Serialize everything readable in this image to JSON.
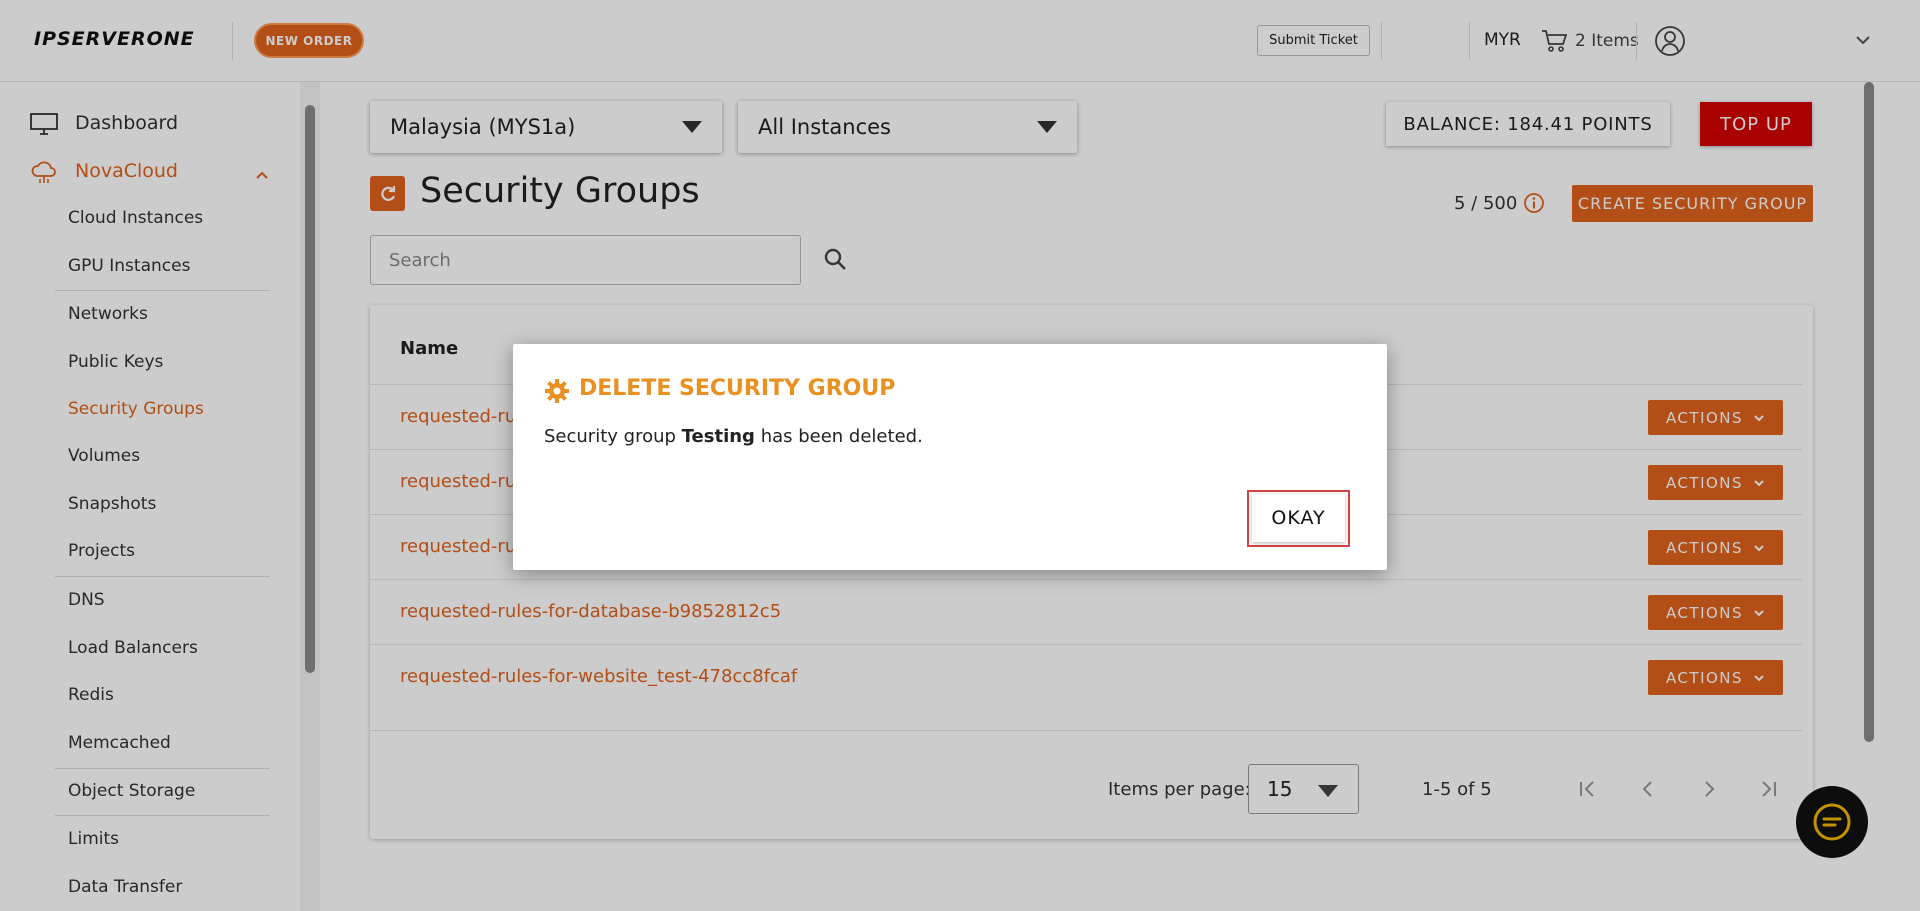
{
  "header": {
    "logo": "IPSERVERONE",
    "new_order": "NEW ORDER",
    "submit_ticket": "Submit Ticket",
    "currency": "MYR",
    "cart": "2 Items"
  },
  "sidebar": {
    "dashboard": "Dashboard",
    "novacloud": "NovaCloud",
    "items": [
      {
        "label": "Cloud Instances"
      },
      {
        "label": "GPU Instances"
      },
      {
        "label": "Networks"
      },
      {
        "label": "Public Keys"
      },
      {
        "label": "Security Groups"
      },
      {
        "label": "Volumes"
      },
      {
        "label": "Snapshots"
      },
      {
        "label": "Projects"
      },
      {
        "label": "DNS"
      },
      {
        "label": "Load Balancers"
      },
      {
        "label": "Redis"
      },
      {
        "label": "Memcached"
      },
      {
        "label": "Object Storage"
      },
      {
        "label": "Limits"
      },
      {
        "label": "Data Transfer"
      }
    ]
  },
  "toolbar": {
    "region": "Malaysia (MYS1a)",
    "instances": "All Instances",
    "balance": "BALANCE: 184.41 POINTS",
    "topup": "TOP UP"
  },
  "page": {
    "title": "Security Groups",
    "quota": "5 / 500",
    "create": "CREATE SECURITY GROUP",
    "search_placeholder": "Search"
  },
  "table": {
    "header_name": "Name",
    "rows": [
      {
        "name": "requested-rul"
      },
      {
        "name": "requested-rul"
      },
      {
        "name": "requested-rul"
      },
      {
        "name": "requested-rules-for-database-b9852812c5"
      },
      {
        "name": "requested-rules-for-website_test-478cc8fcaf"
      }
    ],
    "actions_label": "ACTIONS"
  },
  "pagination": {
    "items_per_page_label": "Items per page:",
    "items_per_page": "15",
    "range": "1-5 of 5"
  },
  "modal": {
    "title": "DELETE SECURITY GROUP",
    "body_prefix": "Security group",
    "body_name": "Testing",
    "body_suffix": "has been deleted.",
    "okay": "OKAY"
  },
  "colors": {
    "accent": "#e0621c",
    "topup": "#d40000",
    "modal_title": "#e89021"
  }
}
